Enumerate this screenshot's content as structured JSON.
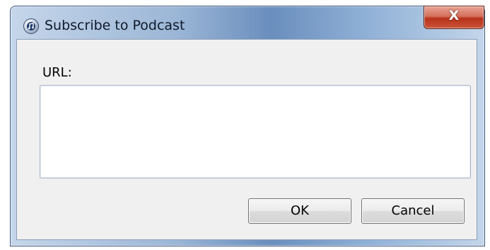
{
  "window": {
    "title": "Subscribe to Podcast",
    "close_glyph": "X",
    "icon": "podcast-app-icon"
  },
  "form": {
    "url_label": "URL:",
    "url_value": ""
  },
  "buttons": {
    "ok_label": "OK",
    "cancel_label": "Cancel"
  },
  "colors": {
    "close_button": "#c9553a",
    "dialog_background": "#f0f0f0"
  }
}
